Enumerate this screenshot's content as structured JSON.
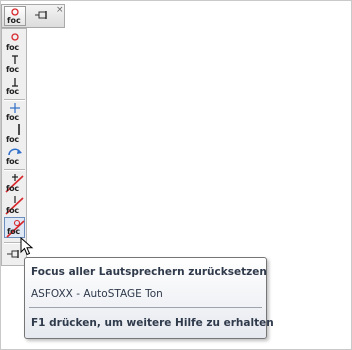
{
  "tool_tabs": {
    "active_tab_icon": "focus-tool-icon",
    "pin_tab_icon": "pin-icon",
    "close_glyph": "×"
  },
  "toolbar": {
    "icon_text": "foc",
    "buttons": [
      {
        "name": "focus-reset-icon"
      },
      {
        "name": "focus-top-icon"
      },
      {
        "name": "focus-bottom-icon"
      },
      {
        "name": "focus-center-icon"
      },
      {
        "name": "focus-vertical-icon"
      },
      {
        "name": "focus-rotate-icon"
      },
      {
        "name": "focus-off-icon"
      },
      {
        "name": "focus-off-down-icon"
      },
      {
        "name": "focus-reset-all-icon",
        "selected": true
      },
      {
        "name": "pin-icon"
      }
    ]
  },
  "tooltip": {
    "title": "Focus aller Lautsprechern zurücksetzen",
    "body": "ASFOXX - AutoSTAGE Ton",
    "footer": "F1 drücken, um weitere Hilfe zu erhalten"
  },
  "colors": {
    "accent_red": "#d8262b",
    "accent_blue": "#2f6ec9",
    "tooltip_text": "#2f3a4b"
  }
}
